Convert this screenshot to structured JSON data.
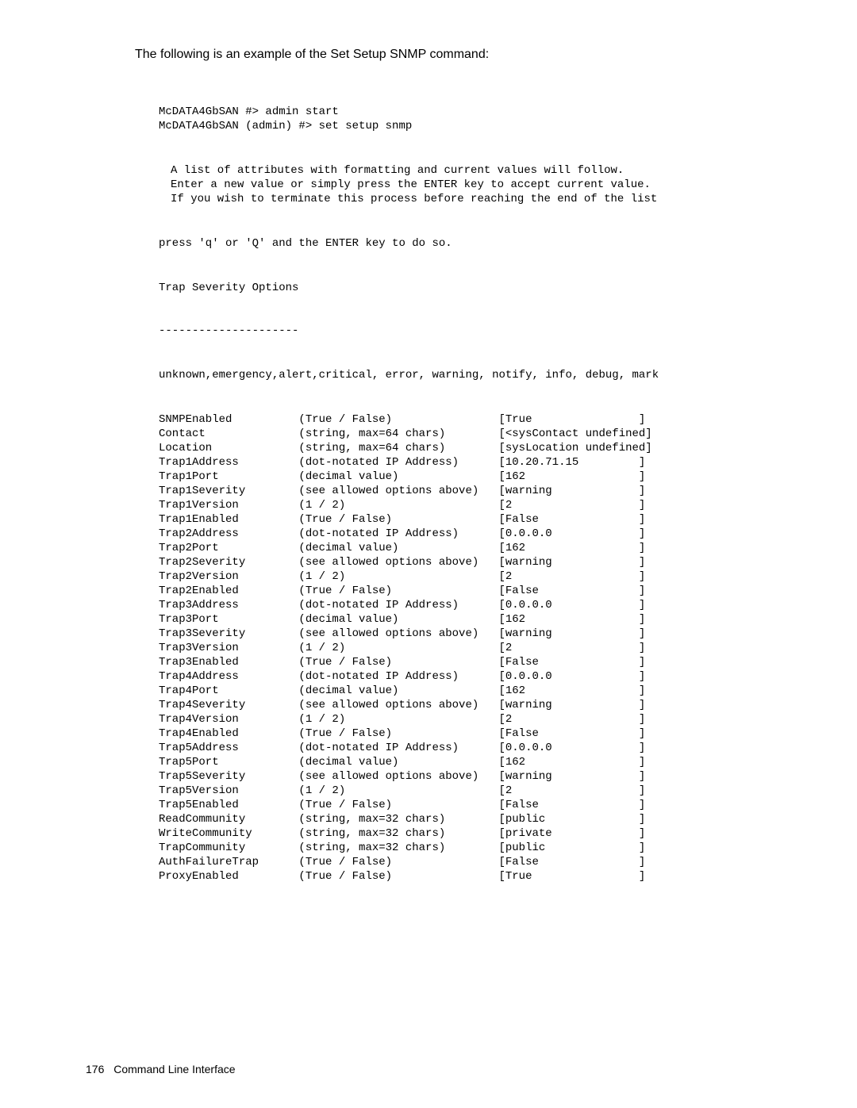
{
  "intro": "The following is an example of the Set Setup SNMP command:",
  "prompt_lines": [
    "McDATA4GbSAN #> admin start",
    "McDATA4GbSAN (admin) #> set setup snmp"
  ],
  "desc_lines": [
    "A list of attributes with formatting and current values will follow.",
    "Enter a new value or simply press the ENTER key to accept current value.",
    "If you wish to terminate this process before reaching the end of the list"
  ],
  "press_line": "press 'q' or 'Q' and the ENTER key to do so.",
  "trap_heading": "Trap Severity Options",
  "dashes": "---------------------",
  "severity_options": "unknown,emergency,alert,critical, error, warning, notify, info, debug, mark",
  "columns": {
    "name_width": 21,
    "desc_width": 30,
    "val_width": 20
  },
  "rows": [
    {
      "name": "SNMPEnabled",
      "desc": "(True / False)",
      "value": "True",
      "pad": true
    },
    {
      "name": "Contact",
      "desc": "(string, max=64 chars)",
      "value": "<sysContact undefined",
      "pad": false
    },
    {
      "name": "Location",
      "desc": "(string, max=64 chars)",
      "value": "sysLocation undefined",
      "pad": false
    },
    {
      "name": "Trap1Address",
      "desc": "(dot-notated IP Address)",
      "value": "10.20.71.15",
      "pad": true
    },
    {
      "name": "Trap1Port",
      "desc": "(decimal value)",
      "value": "162",
      "pad": true
    },
    {
      "name": "Trap1Severity",
      "desc": "(see allowed options above)",
      "value": "warning",
      "pad": true
    },
    {
      "name": "Trap1Version",
      "desc": "(1 / 2)",
      "value": "2",
      "pad": true
    },
    {
      "name": "Trap1Enabled",
      "desc": "(True / False)",
      "value": "False",
      "pad": true
    },
    {
      "name": "Trap2Address",
      "desc": "(dot-notated IP Address)",
      "value": "0.0.0.0",
      "pad": true
    },
    {
      "name": "Trap2Port",
      "desc": "(decimal value)",
      "value": "162",
      "pad": true
    },
    {
      "name": "Trap2Severity",
      "desc": "(see allowed options above)",
      "value": "warning",
      "pad": true
    },
    {
      "name": "Trap2Version",
      "desc": "(1 / 2)",
      "value": "2",
      "pad": true
    },
    {
      "name": "Trap2Enabled",
      "desc": "(True / False)",
      "value": "False",
      "pad": true
    },
    {
      "name": "Trap3Address",
      "desc": "(dot-notated IP Address)",
      "value": "0.0.0.0",
      "pad": true
    },
    {
      "name": "Trap3Port",
      "desc": "(decimal value)",
      "value": "162",
      "pad": true
    },
    {
      "name": "Trap3Severity",
      "desc": "(see allowed options above)",
      "value": "warning",
      "pad": true
    },
    {
      "name": "Trap3Version",
      "desc": "(1 / 2)",
      "value": "2",
      "pad": true
    },
    {
      "name": "Trap3Enabled",
      "desc": "(True / False)",
      "value": "False",
      "pad": true
    },
    {
      "name": "Trap4Address",
      "desc": "(dot-notated IP Address)",
      "value": "0.0.0.0",
      "pad": true
    },
    {
      "name": "Trap4Port",
      "desc": "(decimal value)",
      "value": "162",
      "pad": true
    },
    {
      "name": "Trap4Severity",
      "desc": "(see allowed options above)",
      "value": "warning",
      "pad": true
    },
    {
      "name": "Trap4Version",
      "desc": "(1 / 2)",
      "value": "2",
      "pad": true
    },
    {
      "name": "Trap4Enabled",
      "desc": "(True / False)",
      "value": "False",
      "pad": true
    },
    {
      "name": "Trap5Address",
      "desc": "(dot-notated IP Address)",
      "value": "0.0.0.0",
      "pad": true
    },
    {
      "name": "Trap5Port",
      "desc": "(decimal value)",
      "value": "162",
      "pad": true
    },
    {
      "name": "Trap5Severity",
      "desc": "(see allowed options above)",
      "value": "warning",
      "pad": true
    },
    {
      "name": "Trap5Version",
      "desc": "(1 / 2)",
      "value": "2",
      "pad": true
    },
    {
      "name": "Trap5Enabled",
      "desc": "(True / False)",
      "value": "False",
      "pad": true
    },
    {
      "name": "ReadCommunity",
      "desc": "(string, max=32 chars)",
      "value": "public",
      "pad": true
    },
    {
      "name": "WriteCommunity",
      "desc": "(string, max=32 chars)",
      "value": "private",
      "pad": true
    },
    {
      "name": "TrapCommunity",
      "desc": "(string, max=32 chars)",
      "value": "public",
      "pad": true
    },
    {
      "name": "AuthFailureTrap",
      "desc": "(True / False)",
      "value": "False",
      "pad": true
    },
    {
      "name": "ProxyEnabled",
      "desc": "(True / False)",
      "value": "True",
      "pad": true
    }
  ],
  "footer": {
    "page_number": "176",
    "section": "Command Line Interface"
  }
}
